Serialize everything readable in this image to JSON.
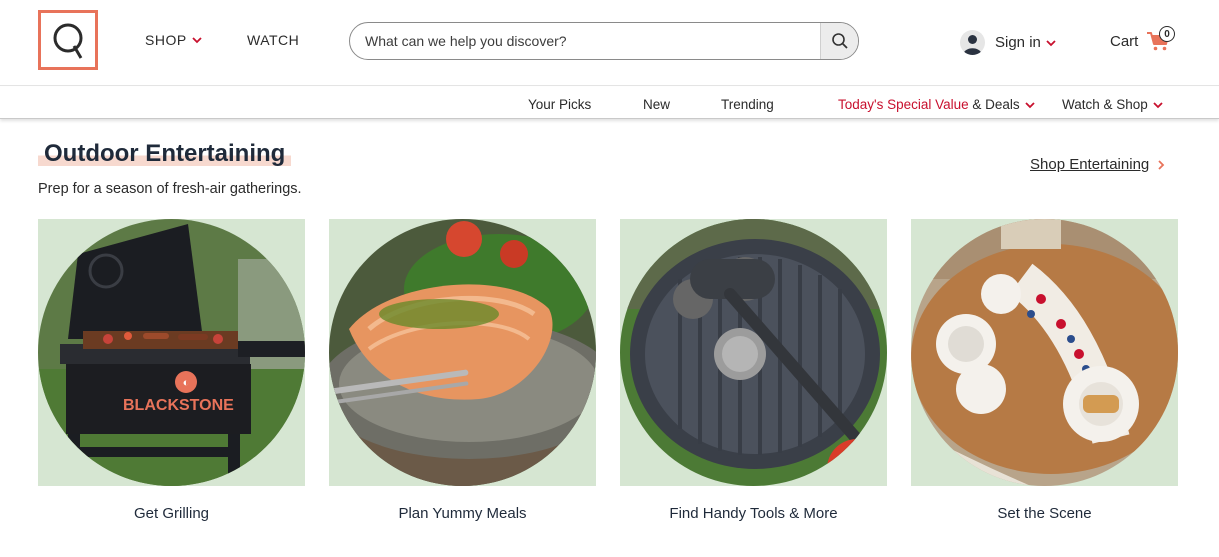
{
  "header": {
    "nav": [
      {
        "label": "SHOP"
      },
      {
        "label": "WATCH"
      }
    ],
    "search": {
      "placeholder": "What can we help you discover?"
    },
    "signin_label": "Sign in",
    "cart_label": "Cart",
    "cart_count": "0",
    "logo_letter": "Q"
  },
  "subnav": {
    "items": [
      {
        "label": "Your Picks"
      },
      {
        "label": "New"
      },
      {
        "label": "Trending"
      }
    ],
    "special_accent": "Today's Special Value",
    "special_rest": " & Deals",
    "watch_shop": "Watch & Shop"
  },
  "section": {
    "title": "Outdoor Entertaining",
    "subtitle": "Prep for a season of fresh-air gatherings.",
    "shop_link": "Shop Entertaining",
    "tiles": [
      {
        "caption": "Get Grilling",
        "brand": "BLACKSTONE"
      },
      {
        "caption": "Plan Yummy Meals"
      },
      {
        "caption": "Find Handy Tools & More"
      },
      {
        "caption": "Set the Scene"
      }
    ]
  },
  "colors": {
    "brand": "#e8735a",
    "accent_red": "#c8102e",
    "tile_bg": "#d6e6d2",
    "title_highlight": "#f7d9cf"
  },
  "icons": [
    "search-icon",
    "user-icon",
    "cart-icon",
    "chevron-down-icon",
    "chevron-right-icon"
  ]
}
